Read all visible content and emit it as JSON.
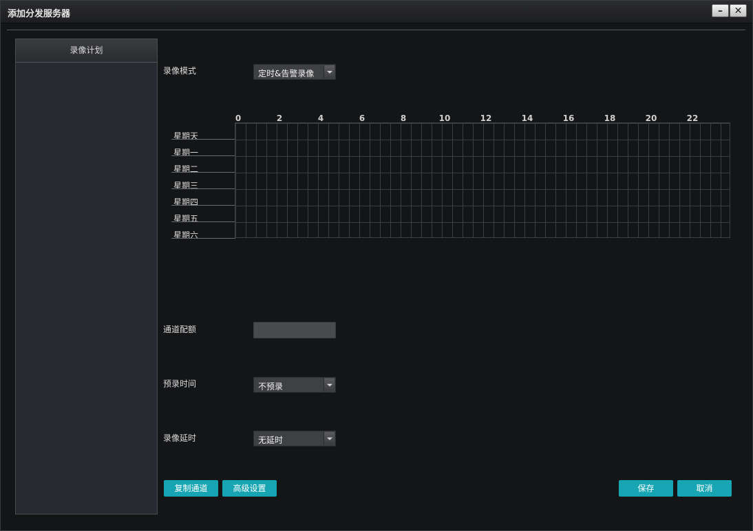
{
  "window": {
    "title": "添加分发服务器",
    "minimize_icon": "minimize-icon",
    "close_icon": "close-icon"
  },
  "sidebar": {
    "header": "录像计划"
  },
  "form": {
    "record_mode_label": "录像模式",
    "record_mode_value": "定时&告警录像",
    "channel_quota_label": "通道配额",
    "channel_quota_value": "",
    "prerecord_label": "预录时间",
    "prerecord_value": "不预录",
    "delay_label": "录像延时",
    "delay_value": "无延时"
  },
  "schedule": {
    "hours": [
      "0",
      "2",
      "4",
      "6",
      "8",
      "10",
      "12",
      "14",
      "16",
      "18",
      "20",
      "22"
    ],
    "days": [
      "星期天",
      "星期一",
      "星期二",
      "星期三",
      "星期四",
      "星期五",
      "星期六"
    ]
  },
  "buttons": {
    "copy_channel": "复制通道",
    "advanced": "高级设置",
    "save": "保存",
    "cancel": "取消"
  },
  "colors": {
    "accent": "#17a5b3",
    "background": "#141517"
  }
}
